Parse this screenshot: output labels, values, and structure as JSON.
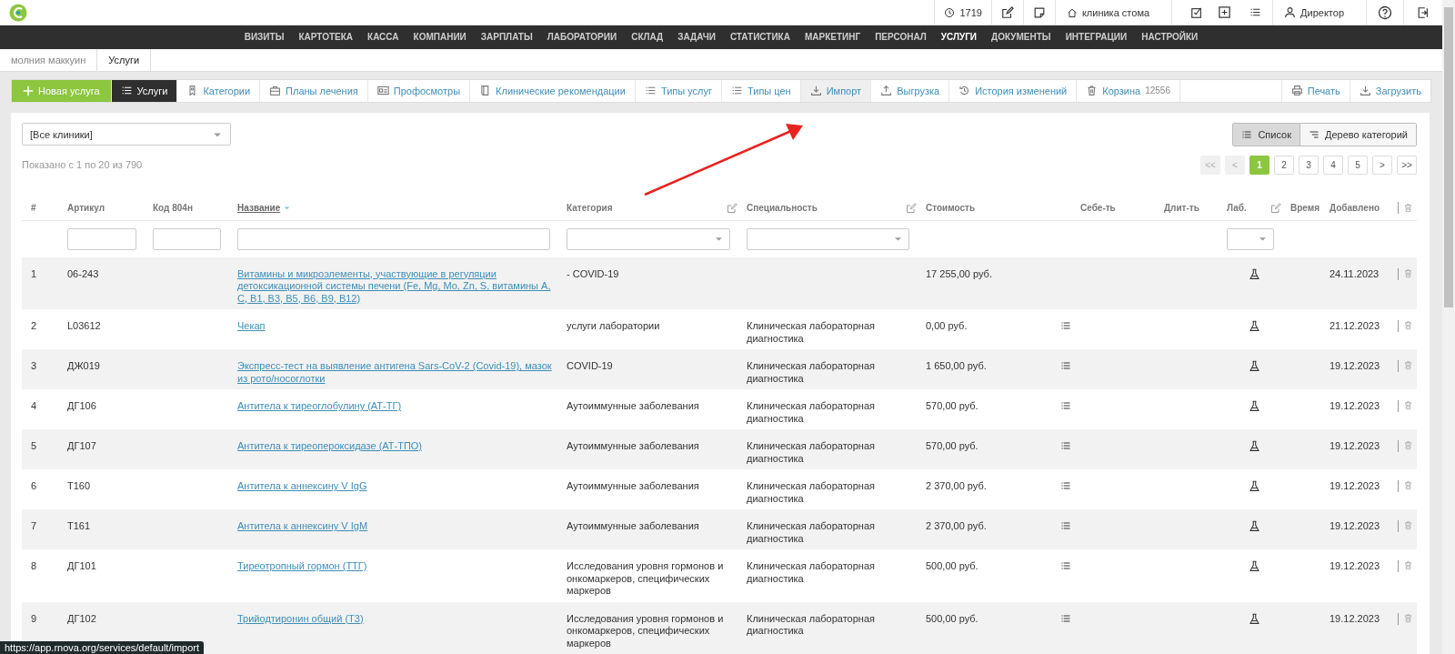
{
  "top_bar": {
    "timer": "1719",
    "clinic": "клиника стома",
    "user": "Директор"
  },
  "nav": [
    {
      "label": "ВИЗИТЫ",
      "selected": false
    },
    {
      "label": "КАРТОТЕКА",
      "selected": false
    },
    {
      "label": "КАССА",
      "selected": false
    },
    {
      "label": "КОМПАНИИ",
      "selected": false
    },
    {
      "label": "ЗАРПЛАТЫ",
      "selected": false
    },
    {
      "label": "ЛАБОРАТОРИИ",
      "selected": false
    },
    {
      "label": "СКЛАД",
      "selected": false
    },
    {
      "label": "ЗАДАЧИ",
      "selected": false
    },
    {
      "label": "СТАТИСТИКА",
      "selected": false
    },
    {
      "label": "МАРКЕТИНГ",
      "selected": false
    },
    {
      "label": "ПЕРСОНАЛ",
      "selected": false
    },
    {
      "label": "УСЛУГИ",
      "selected": true
    },
    {
      "label": "ДОКУМЕНТЫ",
      "selected": false
    },
    {
      "label": "ИНТЕГРАЦИИ",
      "selected": false
    },
    {
      "label": "НАСТРОЙКИ",
      "selected": false
    }
  ],
  "breadcrumbs": [
    {
      "label": "молния маккуин",
      "selected": false
    },
    {
      "label": "Услуги",
      "selected": true
    }
  ],
  "toolbar": {
    "new_button": "Новая услуга",
    "items": [
      {
        "label": "Услуги",
        "selected": true,
        "hovered": false
      },
      {
        "label": "Категории",
        "selected": false,
        "hovered": false
      },
      {
        "label": "Планы лечения",
        "selected": false,
        "hovered": false
      },
      {
        "label": "Профосмотры",
        "selected": false,
        "hovered": false
      },
      {
        "label": "Клинические рекомендации",
        "selected": false,
        "hovered": false
      },
      {
        "label": "Типы услуг",
        "selected": false,
        "hovered": false
      },
      {
        "label": "Типы цен",
        "selected": false,
        "hovered": false
      },
      {
        "label": "Импорт",
        "selected": false,
        "hovered": true
      },
      {
        "label": "Выгрузка",
        "selected": false,
        "hovered": false
      },
      {
        "label": "История изменений",
        "selected": false,
        "hovered": false
      },
      {
        "label": "Корзина",
        "count": "12556",
        "selected": false,
        "hovered": false
      }
    ],
    "actions": [
      "Печать",
      "Загрузить"
    ]
  },
  "clinic_select": "[Все клиники]",
  "view_toggle": [
    {
      "label": "Список",
      "selected": true
    },
    {
      "label": "Дерево категорий",
      "selected": false
    }
  ],
  "summary": "Показано с 1 по 20 из 790",
  "pagination": [
    {
      "label": "<<",
      "selected": false,
      "disabled": true
    },
    {
      "label": "<",
      "selected": false,
      "disabled": true
    },
    {
      "label": "1",
      "selected": true,
      "disabled": false
    },
    {
      "label": "2",
      "selected": false,
      "disabled": false
    },
    {
      "label": "3",
      "selected": false,
      "disabled": false
    },
    {
      "label": "4",
      "selected": false,
      "disabled": false
    },
    {
      "label": "5",
      "selected": false,
      "disabled": false
    },
    {
      "label": ">",
      "selected": false,
      "disabled": false
    },
    {
      "label": ">>",
      "selected": false,
      "disabled": false
    }
  ],
  "table": {
    "filters": [
      {
        "kind": "blank"
      },
      {
        "kind": "text"
      },
      {
        "kind": "text"
      },
      {
        "kind": "text"
      },
      {
        "kind": "select"
      },
      {
        "kind": "select"
      },
      {
        "kind": "blank"
      },
      {
        "kind": "blank"
      },
      {
        "kind": "blank"
      },
      {
        "kind": "select"
      },
      {
        "kind": "blank"
      },
      {
        "kind": "blank"
      },
      {
        "kind": "blank"
      }
    ],
    "columns": [
      {
        "kind": "data",
        "label": "#",
        "sorted": false,
        "editable": false
      },
      {
        "kind": "data",
        "label": "Артикул",
        "sorted": false,
        "editable": false
      },
      {
        "kind": "data",
        "label": "Код 804н",
        "sorted": false,
        "editable": false
      },
      {
        "kind": "data",
        "label": "Название",
        "sorted": true,
        "editable": false
      },
      {
        "kind": "data",
        "label": "Категория",
        "sorted": false,
        "editable": true
      },
      {
        "kind": "data",
        "label": "Специальность",
        "sorted": false,
        "editable": true
      },
      {
        "kind": "data",
        "label": "Стоимость",
        "sorted": false,
        "editable": false
      },
      {
        "kind": "data",
        "label": "Себе-ть",
        "sorted": false,
        "editable": false
      },
      {
        "kind": "data",
        "label": "Длит-ть",
        "sorted": false,
        "editable": false
      },
      {
        "kind": "data",
        "label": "Лаб.",
        "sorted": false,
        "editable": true
      },
      {
        "kind": "data",
        "label": "Время",
        "sorted": false,
        "editable": false
      },
      {
        "kind": "data",
        "label": "Добавлено",
        "sorted": false,
        "editable": false
      },
      {
        "kind": "actions"
      }
    ],
    "rows": [
      {
        "number": "1",
        "article": "06-243",
        "name": "Витамины и микроэлементы, участвующие в регуляции детоксикационной системы печени (Fe, Mg, Mo, Zn, S, витамины A, C, B1, B3, B5, B6, B9, B12)",
        "category": "- COVID-19",
        "price": "17 255,00 руб.",
        "cost_breakdown": false,
        "lab": true,
        "date": "24.11.2023"
      },
      {
        "number": "2",
        "article": "L03612",
        "name": "Чекап",
        "category": "услуги лаборатории",
        "specialty": "Клиническая лабораторная диагностика",
        "price": "0,00 руб.",
        "cost_breakdown": true,
        "lab": true,
        "date": "21.12.2023"
      },
      {
        "number": "3",
        "article": "ДЖ019",
        "name": "Экспресс-тест на выявление антигена Sars-CoV-2 (Covid-19), мазок из рото/носоглотки",
        "category": "COVID-19",
        "specialty": "Клиническая лабораторная диагностика",
        "price": "1 650,00 руб.",
        "cost_breakdown": true,
        "lab": true,
        "date": "19.12.2023"
      },
      {
        "number": "4",
        "article": "ДГ106",
        "name": "Антитела к тиреоглобулину (АТ-ТГ)",
        "category": "Аутоиммунные заболевания",
        "specialty": "Клиническая лабораторная диагностика",
        "price": "570,00 руб.",
        "cost_breakdown": true,
        "lab": true,
        "date": "19.12.2023"
      },
      {
        "number": "5",
        "article": "ДГ107",
        "name": "Антитела к тиреопероксидазе (АТ-ТПО)",
        "category": "Аутоиммунные заболевания",
        "specialty": "Клиническая лабораторная диагностика",
        "price": "570,00 руб.",
        "cost_breakdown": true,
        "lab": true,
        "date": "19.12.2023"
      },
      {
        "number": "6",
        "article": "Т160",
        "name": "Антитела к аннексину V IgG",
        "category": "Аутоиммунные заболевания",
        "specialty": "Клиническая лабораторная диагностика",
        "price": "2 370,00 руб.",
        "cost_breakdown": true,
        "lab": true,
        "date": "19.12.2023"
      },
      {
        "number": "7",
        "article": "Т161",
        "name": "Антитела к аннексину V IgM",
        "category": "Аутоиммунные заболевания",
        "specialty": "Клиническая лабораторная диагностика",
        "price": "2 370,00 руб.",
        "cost_breakdown": true,
        "lab": true,
        "date": "19.12.2023"
      },
      {
        "number": "8",
        "article": "ДГ101",
        "name": "Тиреотропный гормон (ТТГ)",
        "category": "Исследования уровня гормонов и онкомаркеров, специфических маркеров",
        "specialty": "Клиническая лабораторная диагностика",
        "price": "500,00 руб.",
        "cost_breakdown": true,
        "lab": true,
        "date": "19.12.2023"
      },
      {
        "number": "9",
        "article": "ДГ102",
        "name": "Трийодтиронин общий (Т3)",
        "category": "Исследования уровня гормонов и онкомаркеров, специфических маркеров",
        "specialty": "Клиническая лабораторная диагностика",
        "price": "500,00 руб.",
        "cost_breakdown": true,
        "lab": true,
        "date": "19.12.2023"
      }
    ]
  },
  "status_url": "https://app.rnova.org/services/default/import"
}
